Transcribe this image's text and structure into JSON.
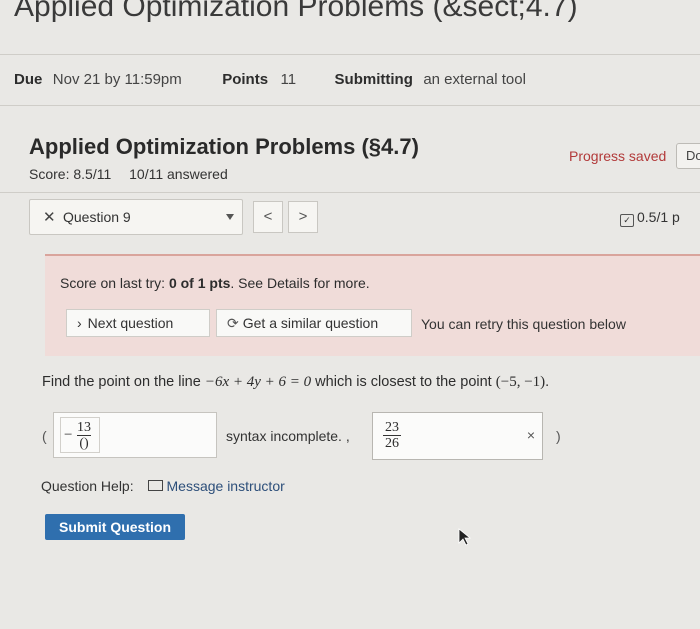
{
  "page_title": "Applied Optimization Problems (&sect;4.7)",
  "meta": {
    "due_label": "Due",
    "due_value": "Nov 21 by 11:59pm",
    "points_label": "Points",
    "points_value": "11",
    "submitting_label": "Submitting",
    "submitting_value": "an external tool"
  },
  "quiz": {
    "title": "Applied Optimization Problems (§4.7)",
    "score": "Score: 8.5/11",
    "answered": "10/11 answered",
    "progress_saved": "Progress saved",
    "done_label": "Do"
  },
  "question_nav": {
    "selected": "Question 9",
    "prev_label": "<",
    "next_label": ">",
    "question_score": "0.5/1 p"
  },
  "feedback": {
    "last_try_prefix": "Score on last try: ",
    "last_try_score": "0 of 1 pts",
    "last_try_suffix": ". See Details for more.",
    "next_question": "Next question",
    "similar_question": "Get a similar question",
    "retry_text": "You can retry this question below"
  },
  "question": {
    "text_before": "Find the point on the line ",
    "equation": "−6x + 4y + 6 = 0",
    "text_middle": " which is closest to the point ",
    "point": "(−5, −1)",
    "text_end": "."
  },
  "answer": {
    "open_paren": "(",
    "a1_sign": "−",
    "a1_num": "13",
    "a1_den": "()",
    "syntax_message": "syntax incomplete. ,",
    "a2_num": "23",
    "a2_den": "26",
    "clear_symbol": "×",
    "close_paren": ")"
  },
  "help": {
    "label": "Question Help:",
    "message_instructor": "Message instructor"
  },
  "submit_label": "Submit Question",
  "colors": {
    "background": "#e9e8e5",
    "accent_red": "#b23a3a",
    "submit_blue": "#2f6fae",
    "feedback_bg": "#f0dcd9"
  }
}
